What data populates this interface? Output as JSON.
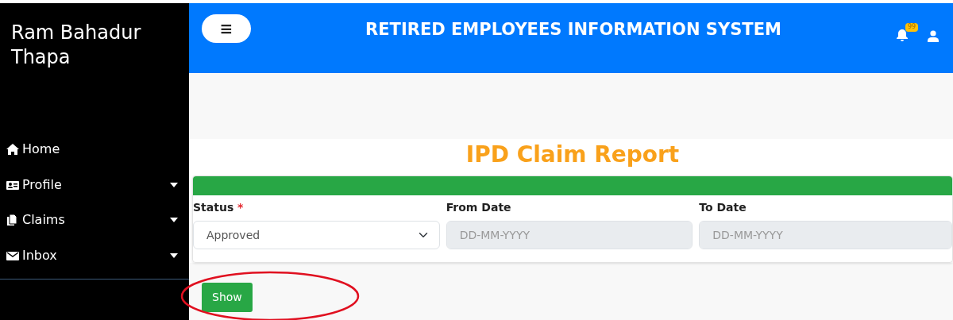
{
  "sidebar": {
    "user_name": "Ram Bahadur Thapa",
    "items": [
      {
        "label": "Home",
        "has_submenu": false
      },
      {
        "label": "Profile",
        "has_submenu": true
      },
      {
        "label": "Claims",
        "has_submenu": true
      },
      {
        "label": "Inbox",
        "has_submenu": true
      }
    ]
  },
  "header": {
    "menu_button": "≡",
    "title": "RETIRED EMPLOYEES INFORMATION SYSTEM",
    "notification_count": "99"
  },
  "report": {
    "title": "IPD Claim Report",
    "fields": [
      {
        "label": "Status",
        "required_mark": "*",
        "kind": "select",
        "value": "Approved"
      },
      {
        "label": "From Date",
        "kind": "date",
        "placeholder": "DD-MM-YYYY"
      },
      {
        "label": "To Date",
        "kind": "date",
        "placeholder": "DD-MM-YYYY"
      }
    ],
    "show_button": "Show"
  }
}
